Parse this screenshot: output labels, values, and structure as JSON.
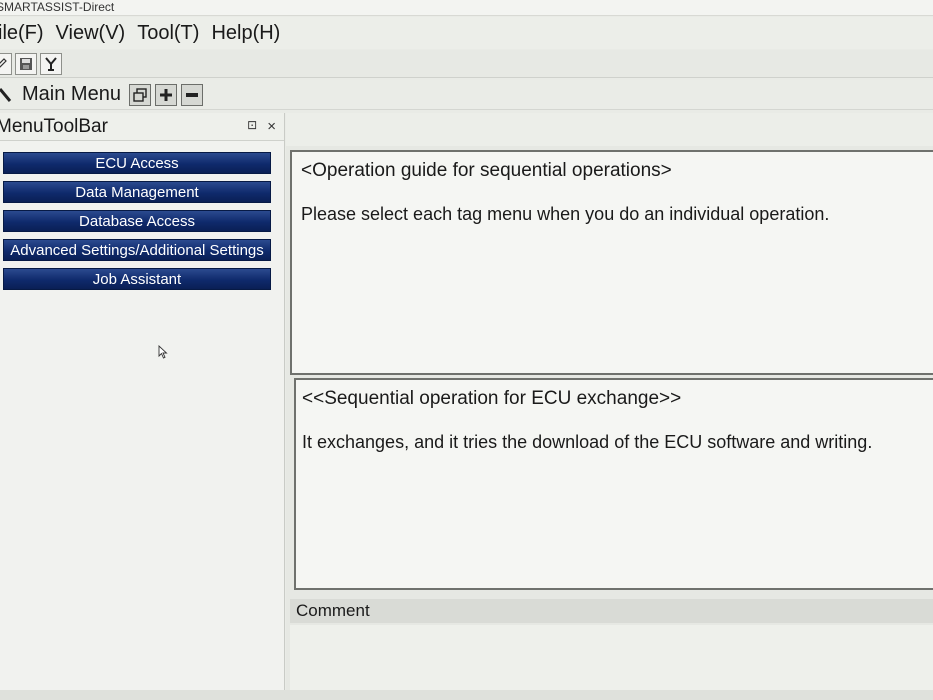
{
  "window": {
    "title": "SMARTASSIST-Direct"
  },
  "menubar": {
    "items": [
      "ile(F)",
      "View(V)",
      "Tool(T)",
      "Help(H)"
    ]
  },
  "toolbar": {
    "icons": [
      "edit-icon",
      "save-icon",
      "tools-icon"
    ]
  },
  "main_menu_bar": {
    "label": "Main Menu",
    "buttons": [
      "restore-window-icon",
      "add-icon",
      "minimize-icon"
    ]
  },
  "left_panel": {
    "title": "MenuToolBar",
    "pin_glyph": "⊡",
    "close_glyph": "×",
    "nav_buttons": [
      "ECU Access",
      "Data Management",
      "Database Access",
      "Advanced Settings/Additional Settings",
      "Job Assistant"
    ]
  },
  "guide_box": {
    "heading": "<Operation guide for sequential operations>",
    "text": "Please select each tag menu when you do an individual operation."
  },
  "sequence_box": {
    "heading": "<<Sequential operation for ECU exchange>>",
    "text": "It exchanges, and it tries the download of the ECU software and writing."
  },
  "comment": {
    "label": "Comment"
  },
  "colors": {
    "nav_button": "#0f2a6c",
    "nav_text": "#ffffff",
    "background": "#e9ebe6"
  }
}
